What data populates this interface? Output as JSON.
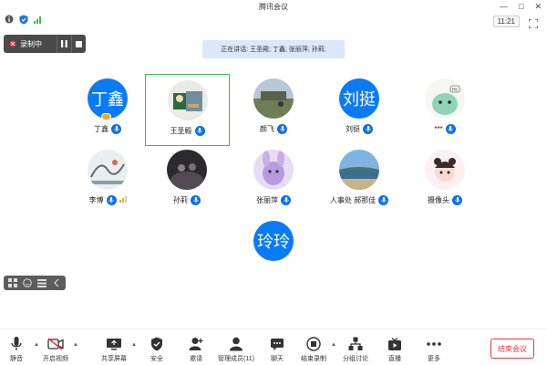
{
  "window": {
    "title": "腾讯会议",
    "controls": [
      "—",
      "□",
      "✕"
    ]
  },
  "status": {
    "timer": "11:21"
  },
  "recording": {
    "label": "录制中"
  },
  "speaking": {
    "text": "正在讲话: 王圣殿; 丁鑫; 张丽萍; 孙莉;"
  },
  "participants": [
    {
      "name": "丁鑫",
      "avatar_text": "丁鑫",
      "avatar_color": "#0a7bf5"
    },
    {
      "name": "王圣殿",
      "avatar_text": ""
    },
    {
      "name": "颜飞",
      "avatar_text": ""
    },
    {
      "name": "刘挺",
      "avatar_text": "刘挺",
      "avatar_color": "#0a7bf5"
    },
    {
      "name": "***",
      "avatar_text": ""
    },
    {
      "name": "李博",
      "avatar_text": ""
    },
    {
      "name": "孙莉",
      "avatar_text": ""
    },
    {
      "name": "张丽萍",
      "avatar_text": ""
    },
    {
      "name": "人事处 郝那佳",
      "avatar_text": ""
    },
    {
      "name": "摄像头",
      "avatar_text": ""
    },
    {
      "name": "",
      "avatar_text": "玲玲",
      "avatar_color": "#0a7bf5"
    }
  ],
  "toolbar": {
    "mute": "静音",
    "video": "开启视频",
    "share": "共享屏幕",
    "security": "安全",
    "invite": "邀请",
    "members": "管理成员(11)",
    "chat": "聊天",
    "end_record": "结束录制",
    "breakout": "分组讨论",
    "live": "直播",
    "more": "更多",
    "end_meeting": "结束会议"
  },
  "colors": {
    "accent": "#0a7bf5",
    "end": "#e33333",
    "highlight": "#3cbc55"
  }
}
